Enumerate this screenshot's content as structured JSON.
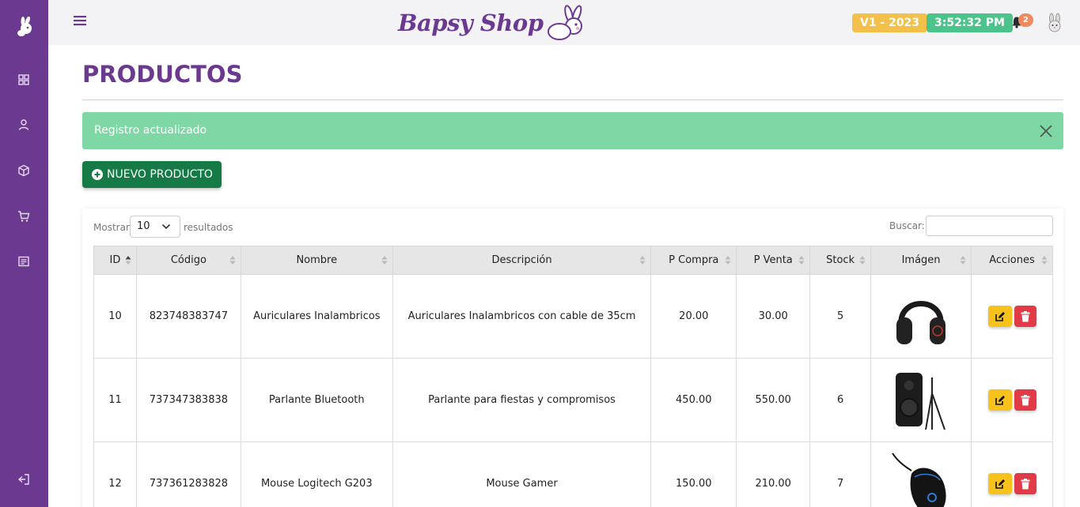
{
  "header": {
    "brand": "Bapsy Shop",
    "version_badge": "V1 - 2023",
    "time_badge": "3:52:32 PM",
    "notification_count": "2",
    "colors": {
      "accent": "#6b3a90",
      "version": "#f3c14b",
      "time": "#4cc38a",
      "notification": "#f08a5d"
    }
  },
  "sidebar": {
    "items": [
      {
        "icon": "dashboard-icon"
      },
      {
        "icon": "user-icon"
      },
      {
        "icon": "box-icon"
      },
      {
        "icon": "cart-icon"
      },
      {
        "icon": "report-icon"
      },
      {
        "icon": "logout-icon"
      }
    ]
  },
  "page": {
    "title": "PRODUCTOS"
  },
  "alert": {
    "message": "Registro actualizado",
    "color": "#7fd7a5"
  },
  "toolbar": {
    "new_label": "NUEVO PRODUCTO"
  },
  "table_controls": {
    "show_label": "Mostrar",
    "page_size": "10",
    "results_label": "resultados",
    "search_label": "Buscar:"
  },
  "table": {
    "columns": [
      "ID",
      "Código",
      "Nombre",
      "Descripción",
      "P Compra",
      "P Venta",
      "Stock",
      "Imágen",
      "Acciones"
    ],
    "rows": [
      {
        "id": "10",
        "codigo": "823748383747",
        "nombre": "Auriculares Inalambricos",
        "descripcion": "Auriculares Inalambricos con cable de 35cm",
        "p_compra": "20.00",
        "p_venta": "30.00",
        "stock": "5",
        "image": "headphones"
      },
      {
        "id": "11",
        "codigo": "737347383838",
        "nombre": "Parlante Bluetooth",
        "descripcion": "Parlante para fiestas y compromisos",
        "p_compra": "450.00",
        "p_venta": "550.00",
        "stock": "6",
        "image": "speaker"
      },
      {
        "id": "12",
        "codigo": "737361283828",
        "nombre": "Mouse Logitech G203",
        "descripcion": "Mouse Gamer",
        "p_compra": "150.00",
        "p_venta": "210.00",
        "stock": "7",
        "image": "mouse"
      }
    ]
  }
}
